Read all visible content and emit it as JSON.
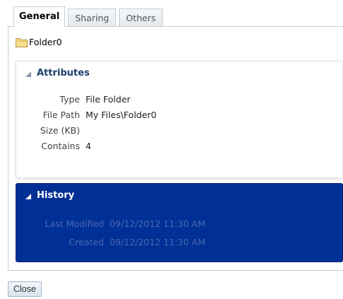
{
  "tabs": [
    {
      "label": "General",
      "active": true
    },
    {
      "label": "Sharing",
      "active": false
    },
    {
      "label": "Others",
      "active": false
    }
  ],
  "folder": {
    "icon": "folder-icon",
    "name": "Folder0"
  },
  "attributes": {
    "title": "Attributes",
    "icon": "triangle-expanded-icon",
    "rows": [
      {
        "label": "Type",
        "value": "File Folder"
      },
      {
        "label": "File Path",
        "value": "My Files\\Folder0"
      },
      {
        "label": "Size (KB)",
        "value": ""
      },
      {
        "label": "Contains",
        "value": "4"
      }
    ]
  },
  "history": {
    "title": "History",
    "icon": "triangle-expanded-icon",
    "background": "#003095",
    "rows": [
      {
        "label": "Last Modified",
        "value": "09/12/2012 11:30 AM"
      },
      {
        "label": "Created",
        "value": "09/12/2012 11:30 AM"
      }
    ]
  },
  "footer": {
    "close_label": "Close"
  }
}
